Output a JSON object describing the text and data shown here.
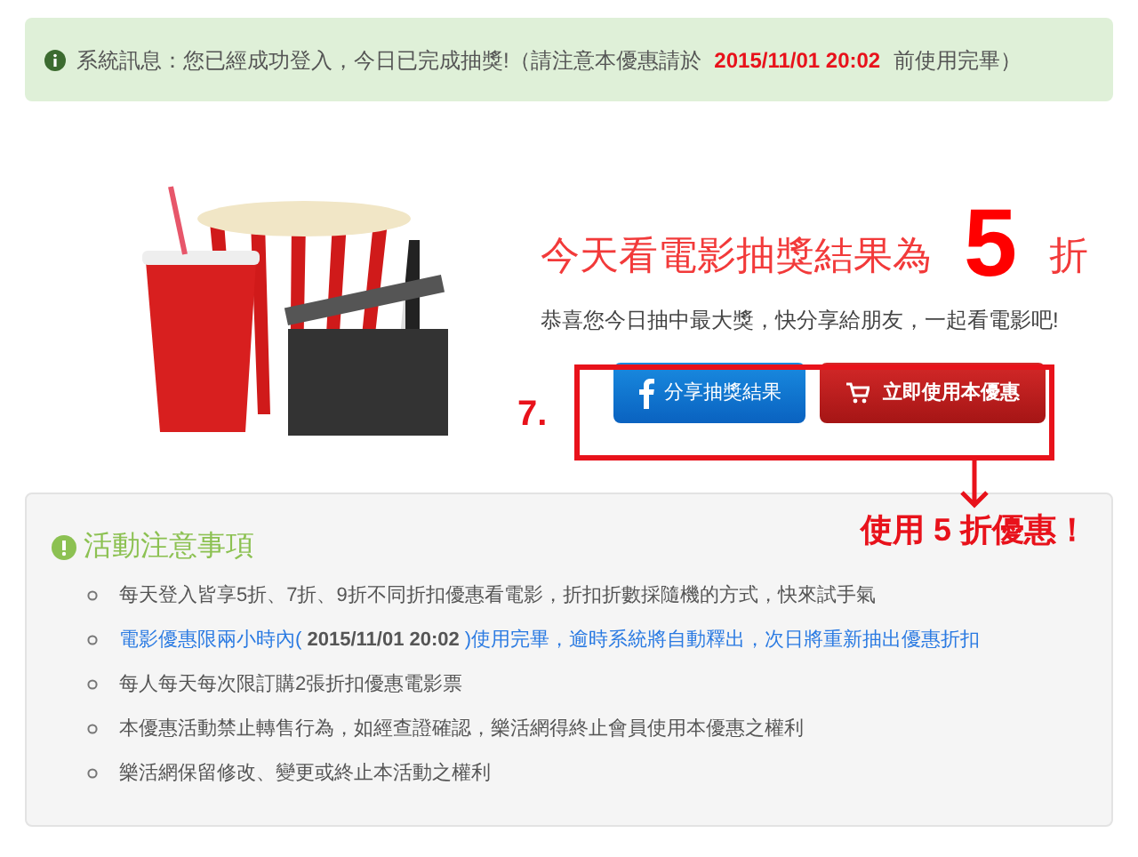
{
  "alert": {
    "text": "系統訊息：您已經成功登入，今日已完成抽獎!（請注意本優惠請於 **2015/11/01 20:02** 前使用完畢）"
  },
  "result": {
    "title": "今天看電影抽獎結果為",
    "discount": "5",
    "unit": "折",
    "message": "恭喜您今日抽中最大獎，快分享給朋友，一起看電影吧!"
  },
  "buttons": [
    {
      "kind": "share",
      "label": "分享抽獎結果"
    },
    {
      "kind": "use",
      "label": "立即使用本優惠"
    }
  ],
  "annotation": {
    "step": "7.",
    "callout": "使用 5 折優惠！"
  },
  "notice": {
    "title": "活動注意事項",
    "items": [
      {
        "kind": "normal",
        "text": "每天登入皆享5折、7折、9折不同折扣優惠看電影，折扣折數採隨機的方式，快來試手氣"
      },
      {
        "kind": "highlight",
        "text": "電影優惠限兩小時內( **2015/11/01 20:02** )使用完畢，逾時系統將自動釋出，次日將重新抽出優惠折扣"
      },
      {
        "kind": "normal",
        "text": "每人每天每次限訂購2張折扣優惠電影票"
      },
      {
        "kind": "normal",
        "text": "本優惠活動禁止轉售行為，如經查證確認，樂活網得終止會員使用本優惠之權利"
      },
      {
        "kind": "normal",
        "text": "樂活網保留修改、變更或終止本活動之權利"
      }
    ]
  }
}
